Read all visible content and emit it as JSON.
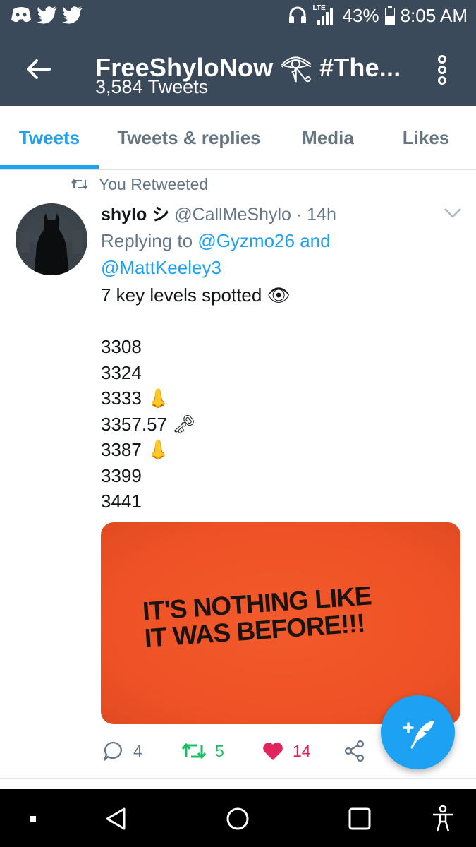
{
  "status_bar": {
    "battery_percent": "43%",
    "time": "8:05 AM",
    "network_label": "LTE",
    "left_icons": [
      "discord-icon",
      "twitter-bird-icon",
      "twitter-bird-icon"
    ],
    "right_icons": [
      "headset-icon",
      "signal-icon",
      "battery-icon"
    ]
  },
  "app_bar": {
    "title": "FreeShyloNow 𓂀 #The...",
    "tweet_count": "3,584 Tweets",
    "back_icon": "arrow-left-icon",
    "overflow_icon": "more-vertical-icon"
  },
  "tabs": [
    {
      "label": "Tweets",
      "active": true
    },
    {
      "label": "Tweets & replies",
      "active": false
    },
    {
      "label": "Media",
      "active": false
    },
    {
      "label": "Likes",
      "active": false
    }
  ],
  "tweet": {
    "retweet_context": "You Retweeted",
    "author_name": "shylo シ",
    "handle_time": "@CallMeShylo · 14h",
    "replying_prefix": "Replying to ",
    "mention_1": "@Gyzmo26",
    "mention_joiner": " and",
    "mention_2": "@MattKeeley3",
    "text": "7 key levels spotted 👁\n\n3308\n3324\n3333 👃\n3357.57 🗝\n3387 👃\n3399\n3441",
    "media_caption": "IT'S NOTHING LIKE\nIT WAS BEFORE!!!",
    "replies": "4",
    "retweets": "5",
    "likes": "14"
  },
  "colors": {
    "bar": "#3b4a5b",
    "accent": "#1da1f2",
    "retweet_green": "#17bf63",
    "like_red": "#e0245e",
    "media_orange": "#f25a2b"
  },
  "nav_bar": {
    "icons": [
      "dot-icon",
      "back-triangle-icon",
      "home-circle-icon",
      "recents-square-icon",
      "accessibility-icon"
    ]
  }
}
